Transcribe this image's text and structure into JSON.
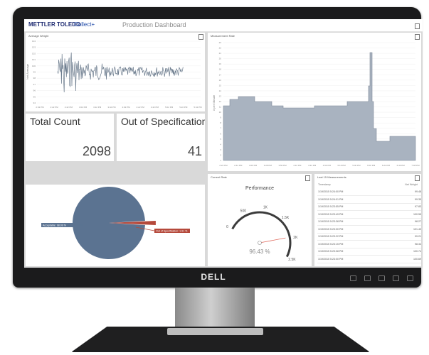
{
  "app": {
    "brand": "METTLER TOLEDO",
    "product": "Collect+",
    "title": "Production Dashboard"
  },
  "monitor": {
    "logo": "DELL"
  },
  "average_weight": {
    "title": "Average Weight",
    "ylabel": "Net Average",
    "y_ticks": [
      "104",
      "103",
      "102",
      "101",
      "100",
      "99",
      "98",
      "97",
      "96",
      "95",
      "94"
    ],
    "x_ticks": [
      "2:02 PM",
      "2:22 PM",
      "2:42 PM",
      "3:02 PM",
      "3:22 PM",
      "3:42 PM",
      "4:02 PM",
      "4:22 PM",
      "4:42 PM",
      "5:02 PM",
      "5:22 PM",
      "5:42 PM"
    ]
  },
  "measurement_rate": {
    "title": "Measurement Rate",
    "ylabel": "# per Minute",
    "y_ticks": [
      "23",
      "22",
      "21",
      "20",
      "19",
      "18",
      "17",
      "16",
      "15",
      "14",
      "13",
      "12",
      "11",
      "10",
      "9",
      "8",
      "7",
      "6",
      "5",
      "4",
      "3",
      "2",
      "1"
    ],
    "x_ticks": [
      "2:22 PM",
      "2:44 PM",
      "3:06 PM",
      "3:28 PM",
      "3:50 PM",
      "4:12 PM",
      "4:34 PM",
      "4:56 PM",
      "5:18 PM",
      "5:40 PM",
      "6:02 PM",
      "6:24 PM",
      "6:46 PM",
      "7:08 PM"
    ]
  },
  "total_count": {
    "label": "Total Count",
    "value": "2098"
  },
  "out_of_spec": {
    "label": "Out of Specification",
    "value": "41"
  },
  "pie": {
    "accepted_label": "Acceptable: 98.09 %",
    "oos_label": "Out of Specification: 1.91 %",
    "accepted_pct": 98.09,
    "oos_pct": 1.91,
    "colors": {
      "accepted": "#5b7391",
      "oos": "#b5493b"
    }
  },
  "current_rate": {
    "title": "Current Rate",
    "gauge_title": "Performance",
    "ticks": [
      "0",
      "500",
      "1K",
      "1.5K",
      "2K",
      "2.5K"
    ],
    "value_text": "96.43 %",
    "value_fraction": 0.9643
  },
  "last_measurements": {
    "title": "Last 15 Measurements",
    "col_time": "Timestamp",
    "col_weight": "Net Weight",
    "rows": [
      {
        "time": "1/19/2015 5:24:00 PM",
        "weight": "99.48"
      },
      {
        "time": "1/19/2015 5:24:01 PM",
        "weight": "99.35"
      },
      {
        "time": "1/19/2015 5:23:55 PM",
        "weight": "97.83"
      },
      {
        "time": "1/19/2015 5:23:49 PM",
        "weight": "100.55"
      },
      {
        "time": "1/19/2015 5:23:38 PM",
        "weight": "98.27"
      },
      {
        "time": "1/19/2015 5:23:30 PM",
        "weight": "101.43"
      },
      {
        "time": "1/19/2015 5:23:22 PM",
        "weight": "99.21"
      },
      {
        "time": "1/19/2015 5:23:15 PM",
        "weight": "98.34"
      },
      {
        "time": "1/19/2015 5:23:08 PM",
        "weight": "100.74"
      },
      {
        "time": "1/19/2015 5:23:00 PM",
        "weight": "100.69"
      }
    ]
  }
}
